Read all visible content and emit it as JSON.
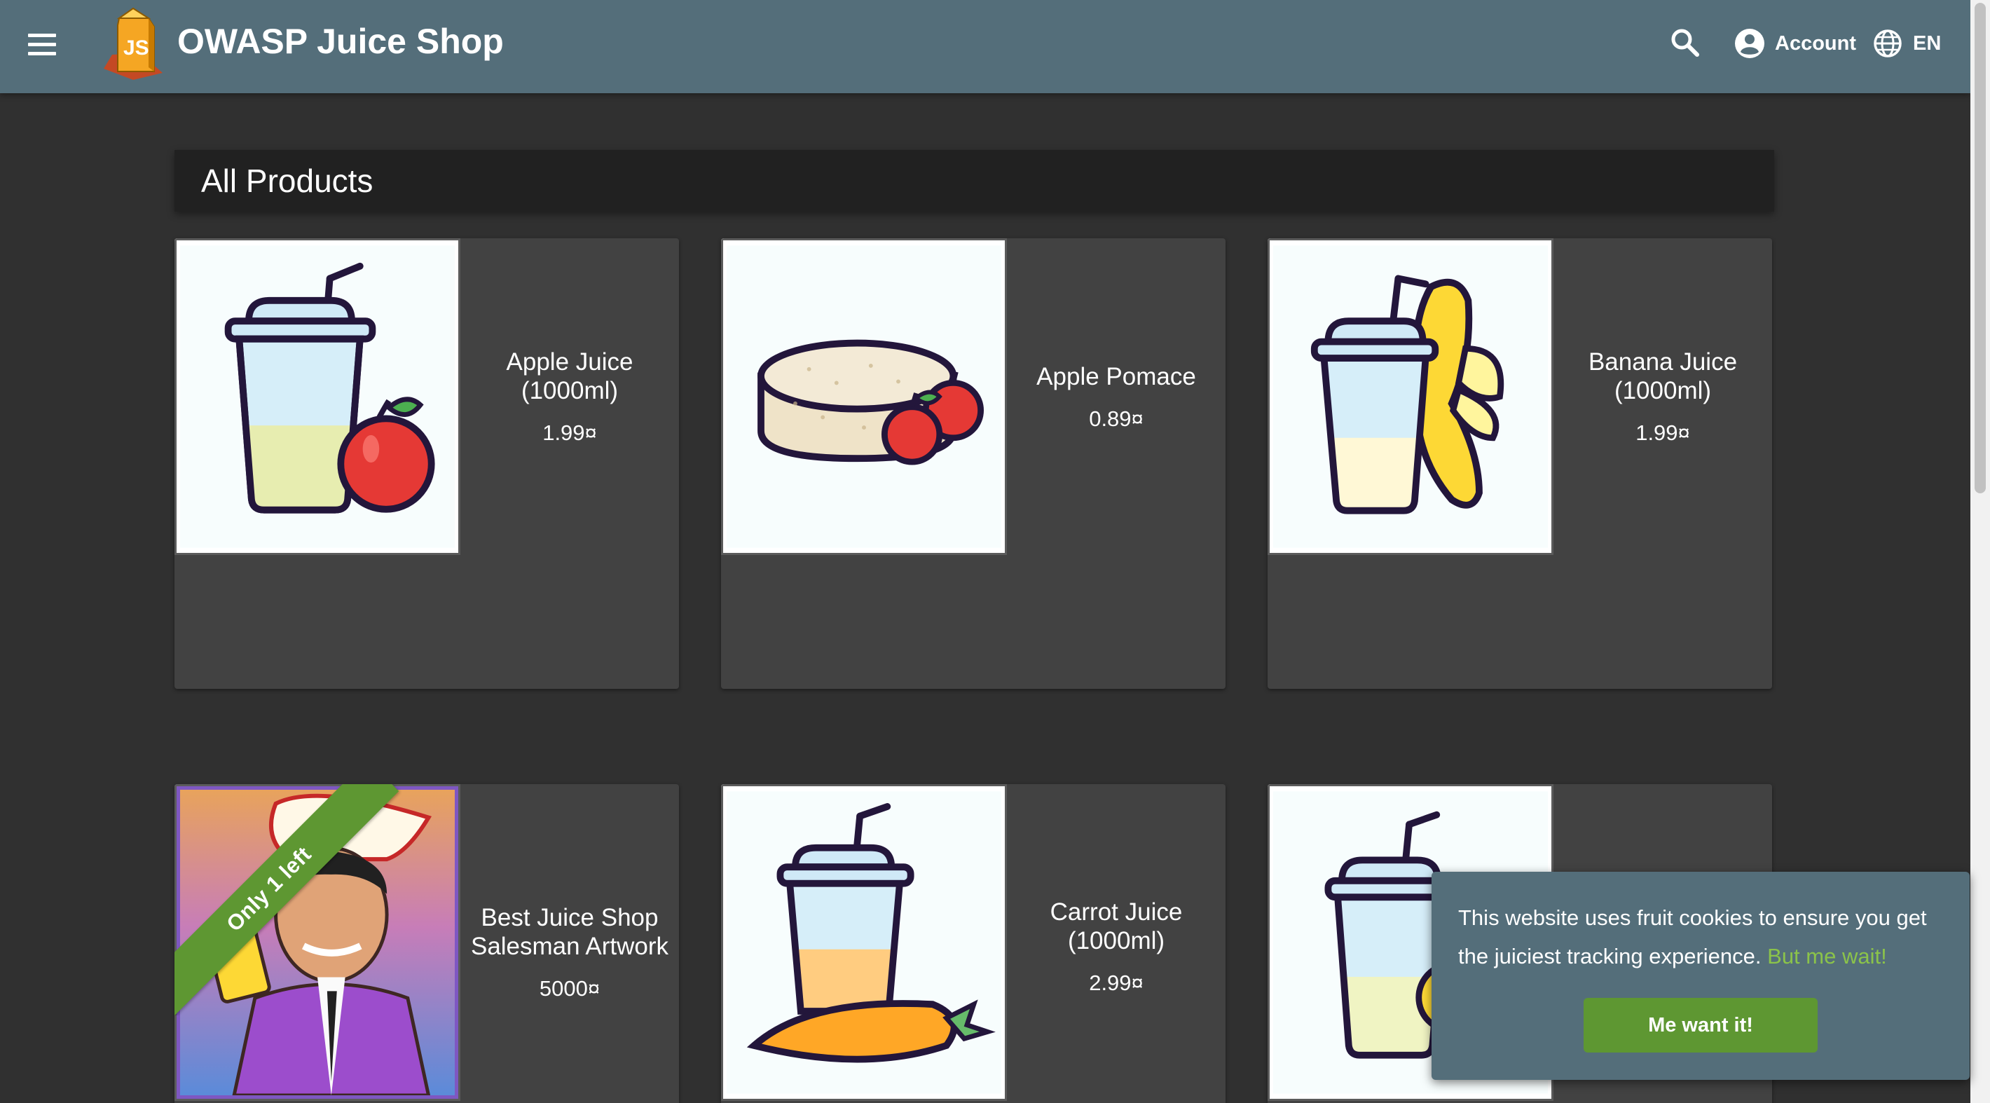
{
  "toolbar": {
    "title": "OWASP Juice Shop",
    "account_label": "Account",
    "language_label": "EN",
    "menu_icon": "hamburger-menu-icon",
    "search_icon": "search-icon",
    "account_icon": "account-circle-icon",
    "language_icon": "globe-icon"
  },
  "main": {
    "heading": "All Products"
  },
  "products": [
    {
      "name": "Apple Juice (1000ml)",
      "price": "1.99¤",
      "image": "apple-juice-cup"
    },
    {
      "name": "Apple Pomace",
      "price": "0.89¤",
      "image": "apple-pomace"
    },
    {
      "name": "Banana Juice (1000ml)",
      "price": "1.99¤",
      "image": "banana-juice-cup"
    },
    {
      "name": "Best Juice Shop Salesman Artwork",
      "price": "5000¤",
      "image": "salesman-artwork",
      "ribbon": "Only 1 left"
    },
    {
      "name": "Carrot Juice (1000ml)",
      "price": "2.99¤",
      "image": "carrot-juice-cup"
    },
    {
      "name": "",
      "price": "",
      "image": "juice-cup-partial"
    }
  ],
  "cookie_banner": {
    "message": "This website uses fruit cookies to ensure you get the juiciest tracking experience.",
    "learn_more": "But me wait!",
    "dismiss_label": "Me want it!"
  },
  "colors": {
    "toolbar": "#546e7a",
    "background": "#303030",
    "card": "#424242",
    "heading_bar": "#212121",
    "accent_green": "#5e9732",
    "link_green": "#8bc34a"
  }
}
